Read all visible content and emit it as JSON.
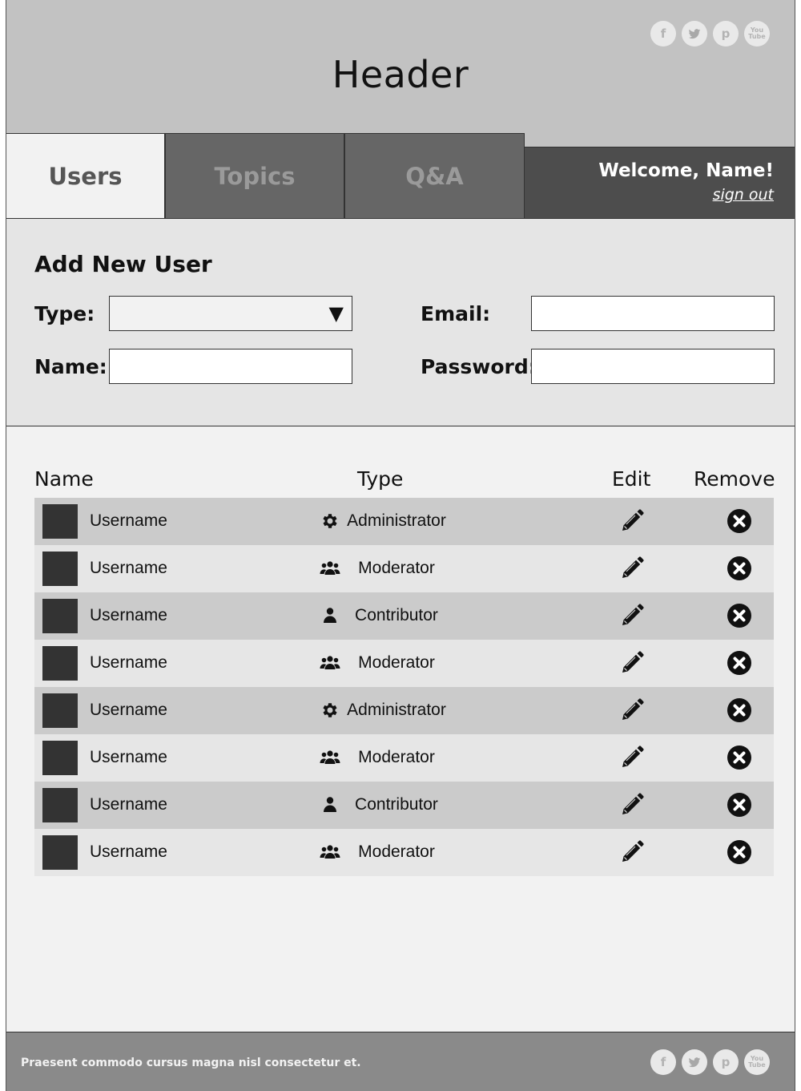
{
  "header": {
    "title": "Header",
    "social": [
      {
        "name": "facebook",
        "glyph": "f"
      },
      {
        "name": "twitter",
        "glyph": "t"
      },
      {
        "name": "pinterest",
        "glyph": "p"
      },
      {
        "name": "youtube",
        "glyph_top": "You",
        "glyph_bottom": "Tube"
      }
    ]
  },
  "tabs": [
    {
      "label": "Users",
      "active": true
    },
    {
      "label": "Topics",
      "active": false
    },
    {
      "label": "Q&A",
      "active": false
    }
  ],
  "welcome": {
    "text": "Welcome, Name!",
    "sign_out": "sign out"
  },
  "form": {
    "title": "Add New User",
    "type_label": "Type:",
    "type_value": "",
    "name_label": "Name:",
    "name_value": "",
    "email_label": "Email:",
    "email_value": "",
    "password_label": "Password:",
    "password_value": ""
  },
  "table": {
    "headers": {
      "name": "Name",
      "type": "Type",
      "edit": "Edit",
      "remove": "Remove"
    },
    "rows": [
      {
        "username": "Username",
        "type": "Administrator",
        "icon": "gear-icon"
      },
      {
        "username": "Username",
        "type": "Moderator",
        "icon": "users-icon"
      },
      {
        "username": "Username",
        "type": "Contributor",
        "icon": "user-icon"
      },
      {
        "username": "Username",
        "type": "Moderator",
        "icon": "users-icon"
      },
      {
        "username": "Username",
        "type": "Administrator",
        "icon": "gear-icon"
      },
      {
        "username": "Username",
        "type": "Moderator",
        "icon": "users-icon"
      },
      {
        "username": "Username",
        "type": "Contributor",
        "icon": "user-icon"
      },
      {
        "username": "Username",
        "type": "Moderator",
        "icon": "users-icon"
      }
    ]
  },
  "footer": {
    "text": "Praesent commodo cursus magna nisl consectetur et."
  },
  "colors": {
    "header_bg": "#c2c2c2",
    "tab_inactive_bg": "#666666",
    "welcome_bg": "#4d4d4d",
    "footer_bg": "#8a8a8a",
    "row_dark": "#cbcbcb",
    "row_light": "#e6e6e6"
  }
}
